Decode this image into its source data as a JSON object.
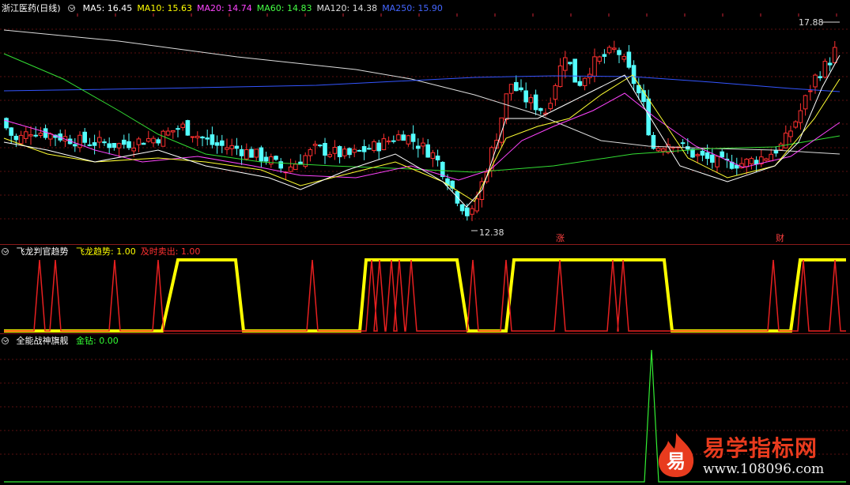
{
  "main_panel": {
    "stock_name": "浙江医药(日线)",
    "ma_labels": [
      {
        "text": "MA5: 16.45",
        "color": "#ffffff"
      },
      {
        "text": "MA10: 15.63",
        "color": "#ffff00"
      },
      {
        "text": "MA20: 14.74",
        "color": "#ff44ff"
      },
      {
        "text": "MA60: 14.83",
        "color": "#44ff44"
      },
      {
        "text": "MA120: 14.38",
        "color": "#dddddd"
      },
      {
        "text": "MA250: 15.90",
        "color": "#4466ff"
      }
    ],
    "high_label": "17.88",
    "low_label": "12.38",
    "markers": [
      "涨",
      "财"
    ]
  },
  "indicator1": {
    "name": "飞龙判官趋势",
    "values": [
      {
        "text": "飞龙趋势: 1.00",
        "color": "#ffff00"
      },
      {
        "text": "及时卖出: 1.00",
        "color": "#ff3030"
      }
    ]
  },
  "indicator2": {
    "name": "全能战神旗舰",
    "values": [
      {
        "text": "金钻: 0.00",
        "color": "#33ff33"
      }
    ]
  },
  "watermark": {
    "logo_char": "易",
    "title": "易学指标网",
    "url": "www.108096.com"
  }
}
